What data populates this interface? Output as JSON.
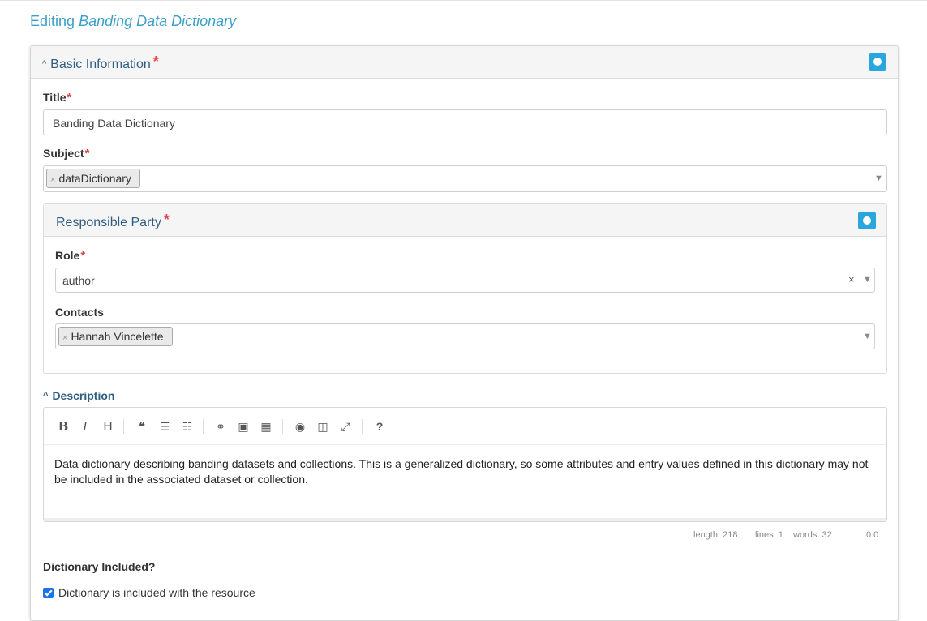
{
  "page": {
    "heading_prefix": "Editing",
    "heading_name": "Banding Data Dictionary"
  },
  "basic": {
    "panel_title": "Basic Information",
    "required_mark": "*",
    "title_label": "Title",
    "title_value": "Banding Data Dictionary",
    "subject_label": "Subject",
    "subject_tags": [
      "dataDictionary"
    ]
  },
  "responsible_party": {
    "panel_title": "Responsible Party",
    "role_label": "Role",
    "role_value": "author",
    "contacts_label": "Contacts",
    "contacts_tags": [
      "Hannah Vincelette"
    ]
  },
  "description": {
    "label": "Description",
    "text": "Data dictionary describing banding datasets and collections. This is a generalized dictionary, so some attributes and entry values defined in this dictionary may not be included in the associated dataset or collection.",
    "toolbar": [
      "bold",
      "italic",
      "heading",
      "quote",
      "unordered-list",
      "ordered-list",
      "link",
      "image",
      "table",
      "preview",
      "side-by-side",
      "fullscreen",
      "guide"
    ],
    "toolbar_glyphs": {
      "bold": "B",
      "italic": "I",
      "heading": "H",
      "quote": "❝",
      "unordered-list": "☰",
      "ordered-list": "☷",
      "link": "⚭",
      "image": "▣",
      "table": "▦",
      "preview": "◉",
      "side-by-side": "◫",
      "fullscreen": "⤢",
      "guide": "?"
    },
    "status": {
      "length": "length: 218",
      "lines": "lines: 1",
      "words": "words: 32",
      "cursor": "0:0"
    }
  },
  "dictionary": {
    "label": "Dictionary Included?",
    "checkbox_label": "Dictionary is included with the resource",
    "checked": true
  },
  "icons": {
    "remove_tag": "×",
    "dropdown_caret": "▼",
    "clear_select": "×",
    "collapse_chevron": "^"
  },
  "colors": {
    "heading": "#3a9fc9",
    "panel_title": "#2f5d82",
    "required": "#e24545",
    "toggle_button": "#29a6dd",
    "checkbox": "#1a73e8"
  }
}
